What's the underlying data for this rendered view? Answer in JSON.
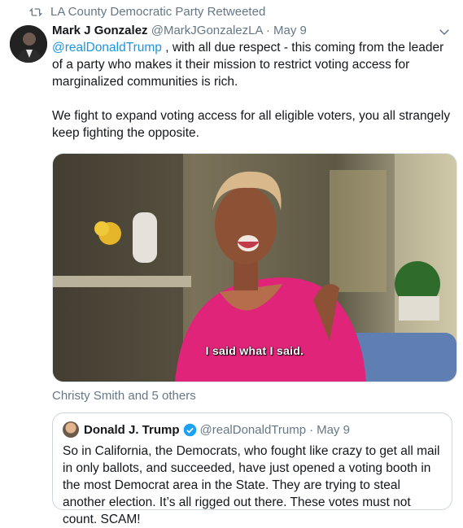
{
  "retweet": {
    "icon": "retweet-icon",
    "label": "LA County Democratic Party Retweeted"
  },
  "tweet": {
    "author_name": "Mark J Gonzalez",
    "author_handle": "@MarkJGonzalezLA",
    "separator": "·",
    "date": "May 9",
    "mention": "@realDonaldTrump",
    "text_after_mention": " , with all due respect - this coming from the leader of a party who makes it their mission to restrict voting access for marginalized communities is rich.",
    "paragraph_2": "We fight to expand voting access for all eligible voters, you all strangely keep fighting the opposite.",
    "media_subtitle": "I said what I said.",
    "social_context": "Christy Smith and 5 others",
    "menu_icon": "chevron-down-icon"
  },
  "quote": {
    "author_name": "Donald J. Trump",
    "verified_icon": "verified-badge-icon",
    "author_handle": "@realDonaldTrump",
    "separator": "·",
    "date": "May 9",
    "text": "So in California, the Democrats, who fought like crazy to get all mail in only ballots, and succeeded, have just opened a voting booth in the most Democrat area in the State. They are trying to steal another election. It’s all rigged out there. These votes must not count. SCAM!"
  },
  "colors": {
    "link": "#1b95e0",
    "muted": "#657786",
    "verified": "#1da1f2"
  }
}
